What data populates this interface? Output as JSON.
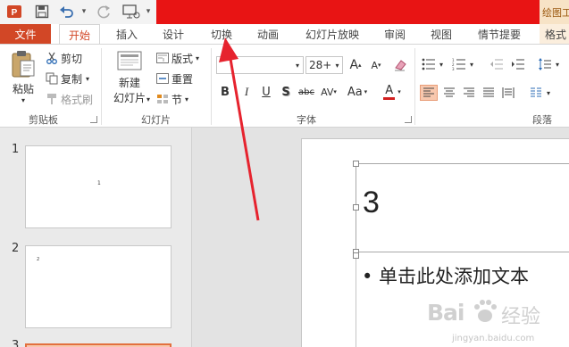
{
  "quick_access": {
    "icons": [
      "app-logo-icon",
      "save-icon",
      "undo-icon",
      "redo-icon",
      "present-icon"
    ]
  },
  "context_tab": {
    "label": "绘图工"
  },
  "tabs": [
    {
      "label": "文件"
    },
    {
      "label": "开始"
    },
    {
      "label": "插入"
    },
    {
      "label": "设计"
    },
    {
      "label": "切换"
    },
    {
      "label": "动画"
    },
    {
      "label": "幻灯片放映"
    },
    {
      "label": "审阅"
    },
    {
      "label": "视图"
    },
    {
      "label": "情节提要"
    },
    {
      "label": "格式"
    }
  ],
  "clipboard": {
    "paste": "粘贴",
    "cut": "剪切",
    "copy": "复制",
    "format_painter": "格式刷",
    "group": "剪贴板"
  },
  "slides_group": {
    "new_slide_line1": "新建",
    "new_slide_line2": "幻灯片",
    "layout": "版式",
    "reset": "重置",
    "section": "节",
    "group": "幻灯片"
  },
  "font_group": {
    "font_name": "",
    "font_size": "28+",
    "bold": "B",
    "italic": "I",
    "underline": "U",
    "shadow": "S",
    "strike": "abc",
    "spacing": "AV",
    "case": "Aa",
    "color": "A",
    "grow": "A",
    "shrink": "A",
    "group": "字体"
  },
  "paragraph_group": {
    "group": "段落"
  },
  "thumbnails": [
    {
      "num": "1",
      "text": "1"
    },
    {
      "num": "2",
      "text": "2"
    },
    {
      "num": "3",
      "text": ""
    }
  ],
  "slide": {
    "title": "3",
    "body": "• 单击此处添加文本"
  },
  "watermark": {
    "brand": "Bai",
    "brand2": "经验",
    "url": "jingyan.baidu.com"
  },
  "colors": {
    "accent": "#d24726",
    "banner": "#e81414",
    "arrow": "#e6232e",
    "selected": "#e3703e"
  }
}
